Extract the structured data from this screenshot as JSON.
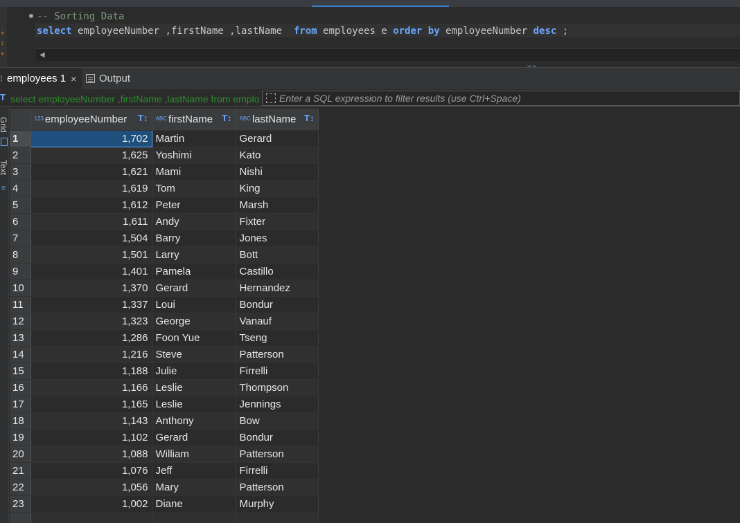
{
  "editor": {
    "comment": "-- Sorting Data",
    "tokens": {
      "select": "select",
      "columns": " employeeNumber ,firstName ,lastName  ",
      "from": "from",
      "table": " employees e ",
      "order": "order",
      "by": "by",
      "column": " employeeNumber ",
      "desc": "desc",
      "end": " ;"
    }
  },
  "result_tabs": {
    "active_label": "employees 1",
    "close_glyph": "×",
    "output_label": "Output"
  },
  "filter": {
    "query_text": "select employeeNumber ,firstName ,lastName from employees e order by employeeNumber desc",
    "placeholder": "Enter a SQL expression to filter results (use Ctrl+Space)"
  },
  "side_panel": {
    "grid_label": "Grid",
    "text_label": "Text"
  },
  "grid": {
    "columns": [
      {
        "label": "employeeNumber",
        "type_badge": "123"
      },
      {
        "label": "firstName",
        "type_badge": "ABC"
      },
      {
        "label": "lastName",
        "type_badge": "ABC"
      }
    ],
    "sort_glyph": "T↕",
    "selected_row": 1,
    "rows": [
      {
        "n": "1",
        "employeeNumber": "1,702",
        "firstName": "Martin",
        "lastName": "Gerard"
      },
      {
        "n": "2",
        "employeeNumber": "1,625",
        "firstName": "Yoshimi",
        "lastName": "Kato"
      },
      {
        "n": "3",
        "employeeNumber": "1,621",
        "firstName": "Mami",
        "lastName": "Nishi"
      },
      {
        "n": "4",
        "employeeNumber": "1,619",
        "firstName": "Tom",
        "lastName": "King"
      },
      {
        "n": "5",
        "employeeNumber": "1,612",
        "firstName": "Peter",
        "lastName": "Marsh"
      },
      {
        "n": "6",
        "employeeNumber": "1,611",
        "firstName": "Andy",
        "lastName": "Fixter"
      },
      {
        "n": "7",
        "employeeNumber": "1,504",
        "firstName": "Barry",
        "lastName": "Jones"
      },
      {
        "n": "8",
        "employeeNumber": "1,501",
        "firstName": "Larry",
        "lastName": "Bott"
      },
      {
        "n": "9",
        "employeeNumber": "1,401",
        "firstName": "Pamela",
        "lastName": "Castillo"
      },
      {
        "n": "10",
        "employeeNumber": "1,370",
        "firstName": "Gerard",
        "lastName": "Hernandez"
      },
      {
        "n": "11",
        "employeeNumber": "1,337",
        "firstName": "Loui",
        "lastName": "Bondur"
      },
      {
        "n": "12",
        "employeeNumber": "1,323",
        "firstName": "George",
        "lastName": "Vanauf"
      },
      {
        "n": "13",
        "employeeNumber": "1,286",
        "firstName": "Foon Yue",
        "lastName": "Tseng"
      },
      {
        "n": "14",
        "employeeNumber": "1,216",
        "firstName": "Steve",
        "lastName": "Patterson"
      },
      {
        "n": "15",
        "employeeNumber": "1,188",
        "firstName": "Julie",
        "lastName": "Firrelli"
      },
      {
        "n": "16",
        "employeeNumber": "1,166",
        "firstName": "Leslie",
        "lastName": "Thompson"
      },
      {
        "n": "17",
        "employeeNumber": "1,165",
        "firstName": "Leslie",
        "lastName": "Jennings"
      },
      {
        "n": "18",
        "employeeNumber": "1,143",
        "firstName": "Anthony",
        "lastName": "Bow"
      },
      {
        "n": "19",
        "employeeNumber": "1,102",
        "firstName": "Gerard",
        "lastName": "Bondur"
      },
      {
        "n": "20",
        "employeeNumber": "1,088",
        "firstName": "William",
        "lastName": "Patterson"
      },
      {
        "n": "21",
        "employeeNumber": "1,076",
        "firstName": "Jeff",
        "lastName": "Firrelli"
      },
      {
        "n": "22",
        "employeeNumber": "1,056",
        "firstName": "Mary",
        "lastName": "Patterson"
      },
      {
        "n": "23",
        "employeeNumber": "1,002",
        "firstName": "Diane",
        "lastName": "Murphy"
      }
    ]
  },
  "colors": {
    "keyword": "#6aa6ff",
    "comment": "#7b9a7b",
    "selection": "#1f4f7d",
    "filter_query": "#2f8a2f"
  }
}
